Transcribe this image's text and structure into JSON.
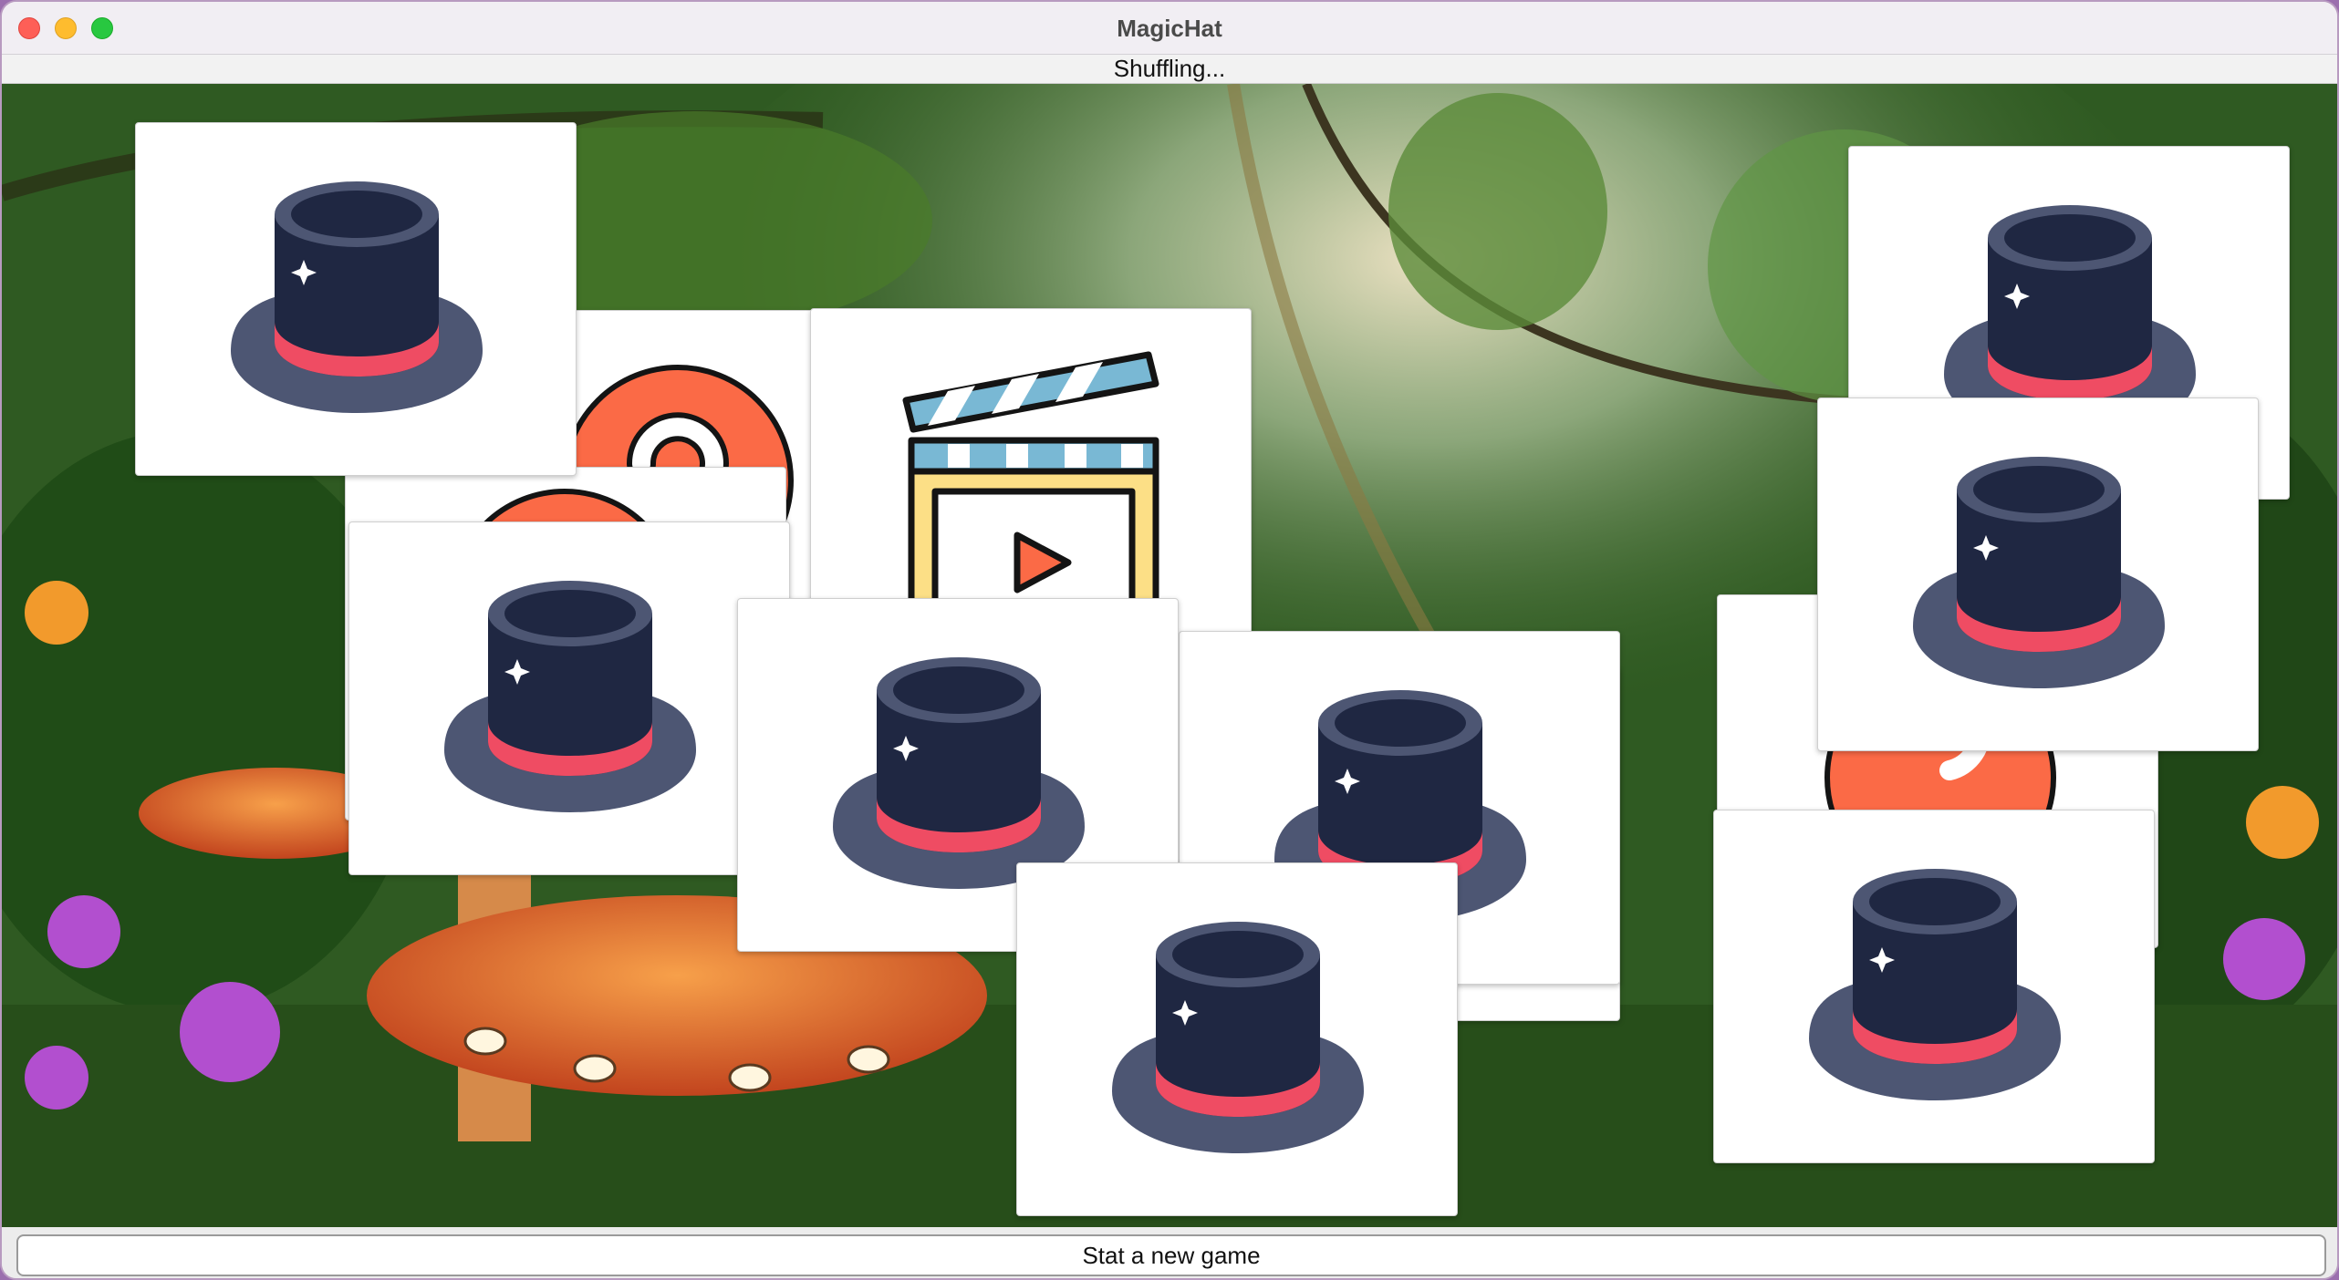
{
  "window": {
    "title": "MagicHat"
  },
  "status": {
    "text": "Shuffling..."
  },
  "controls": {
    "new_game_label": "Stat a new game"
  },
  "colors": {
    "hat_body": "#1f2742",
    "hat_rim": "#4d5673",
    "hat_band": "#ef4c63",
    "question_circle": "#fb6a46",
    "clapper_yellow": "#fcdf86",
    "clapper_stripe": "#79b8d4"
  },
  "cards": [
    {
      "icon": "question-icon"
    },
    {
      "icon": "question-icon"
    },
    {
      "icon": "clapperboard-icon"
    },
    {
      "icon": "question-icon"
    },
    {
      "icon": "question-icon"
    },
    {
      "icon": "top-hat-icon"
    },
    {
      "icon": "top-hat-icon"
    },
    {
      "icon": "top-hat-icon"
    },
    {
      "icon": "top-hat-icon"
    },
    {
      "icon": "top-hat-icon"
    },
    {
      "icon": "top-hat-icon"
    },
    {
      "icon": "top-hat-icon"
    },
    {
      "icon": "top-hat-icon"
    },
    {
      "icon": "top-hat-icon"
    }
  ]
}
